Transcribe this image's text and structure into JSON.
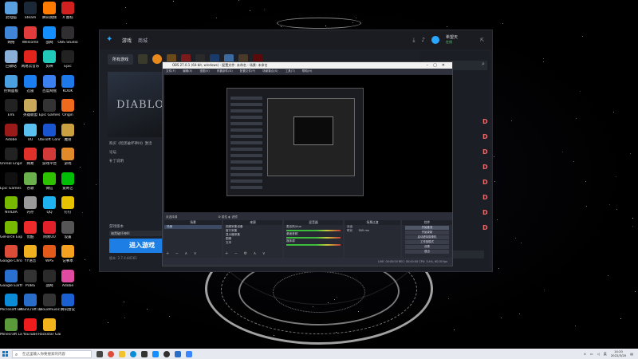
{
  "desktop": {
    "icons": [
      {
        "label": "此电脑",
        "color": "#5aa0e0"
      },
      {
        "label": "Steam",
        "color": "#1b2838"
      },
      {
        "label": "腾讯视频",
        "color": "#ff7a00"
      },
      {
        "label": "X 图标",
        "color": "#d02020"
      },
      {
        "label": "网络",
        "color": "#3f86d8"
      },
      {
        "label": "Welcome",
        "color": "#e23b3b"
      },
      {
        "label": "战网",
        "color": "#148eff"
      },
      {
        "label": "OBS Studio",
        "color": "#302e31"
      },
      {
        "label": "回收站",
        "color": "#8ab0d8"
      },
      {
        "label": "网易云音乐",
        "color": "#e2241d"
      },
      {
        "label": "剪映",
        "color": "#20c9b8"
      },
      {
        "label": "Epic",
        "color": "#222"
      },
      {
        "label": "控制面板",
        "color": "#4aa0e0"
      },
      {
        "label": "迅雷",
        "color": "#1a7ef0"
      },
      {
        "label": "百度网盘",
        "color": "#3b7ff0"
      },
      {
        "label": "KOOK",
        "color": "#1d78e8"
      },
      {
        "label": "EVE",
        "color": "#222"
      },
      {
        "label": "英雄联盟",
        "color": "#c8a85a"
      },
      {
        "label": "Epic Games",
        "color": "#333"
      },
      {
        "label": "Origin",
        "color": "#f06a1e"
      },
      {
        "label": "Adobe",
        "color": "#9a1a1a"
      },
      {
        "label": "UU",
        "color": "#5ac0f0"
      },
      {
        "label": "Ubisoft Connect",
        "color": "#1a55d0"
      },
      {
        "label": "魔兽",
        "color": "#caa040"
      },
      {
        "label": "Unreal Engine",
        "color": "#222"
      },
      {
        "label": "网易",
        "color": "#e0302a"
      },
      {
        "label": "游戏平台",
        "color": "#d23a3a"
      },
      {
        "label": "游戏",
        "color": "#e08a2a"
      },
      {
        "label": "Epic Games Launcher",
        "color": "#111"
      },
      {
        "label": "谷歌",
        "color": "#6ab04c"
      },
      {
        "label": "微信",
        "color": "#2dc100"
      },
      {
        "label": "爱奇艺",
        "color": "#00be06"
      },
      {
        "label": "NVIDIA",
        "color": "#76b900"
      },
      {
        "label": "内存",
        "color": "#9a9a9a"
      },
      {
        "label": "QQ",
        "color": "#1eb2f0"
      },
      {
        "label": "钉钉",
        "color": "#e6c200"
      },
      {
        "label": "GeForce Experience",
        "color": "#76b900"
      },
      {
        "label": "优酷",
        "color": "#ee2a2a"
      },
      {
        "label": "网易UU",
        "color": "#e2202a"
      },
      {
        "label": "设置",
        "color": "#555"
      },
      {
        "label": "Google Chrome",
        "color": "#dd4b39"
      },
      {
        "label": "YY语音",
        "color": "#f0b020"
      },
      {
        "label": "WPS",
        "color": "#e45a1a"
      },
      {
        "label": "记事本",
        "color": "#f4a020"
      },
      {
        "label": "Google Earth Pro",
        "color": "#2a70d0"
      },
      {
        "label": "PUBG",
        "color": "#333"
      },
      {
        "label": "战网",
        "color": "#2a2a2a"
      },
      {
        "label": "Adobe",
        "color": "#e04aa0"
      },
      {
        "label": "Microsoft Edge",
        "color": "#0c8bd6"
      },
      {
        "label": "PlainCraft Launcher",
        "color": "#2a6dc8"
      },
      {
        "label": "Cloudmusic",
        "color": "#333"
      },
      {
        "label": "腾讯会议",
        "color": "#1a60d0"
      },
      {
        "label": "Minecraft Launcher",
        "color": "#5a9a3a"
      },
      {
        "label": "YouTube",
        "color": "#ee1c1c"
      },
      {
        "label": "Rockstar Games",
        "color": "#f2b21c"
      }
    ]
  },
  "launcher": {
    "tabs": [
      "游戏",
      "商城"
    ],
    "user_name": "希望天",
    "user_status": "在线",
    "all_games_label": "所有游戏",
    "game_title": "DIABLO",
    "links": [
      "购买《暗黑破坏神III》激活",
      "论坛",
      "补丁说明"
    ],
    "region_label": "游戏版本",
    "region_value": "暗黑破坏神III",
    "region_sub": "亚洲",
    "play_button": "进入游戏",
    "version": "版本: 2.7.4.84161"
  },
  "obs": {
    "title": "OBS 27.0.1 (64-bit, windows) - 配置文件: 未命名 - 场景: 未命名",
    "menu": [
      "文件(F)",
      "编辑(E)",
      "视图(V)",
      "停靠部件(D)",
      "配置文件(P)",
      "场景集合(S)",
      "工具(T)",
      "帮助(H)"
    ],
    "source_bar": "未选择源",
    "properties_btn": "属性",
    "filters_btn": "滤镜",
    "docks": {
      "scenes": {
        "title": "场景",
        "items": [
          "场景"
        ]
      },
      "sources": {
        "title": "来源",
        "items": [
          "视频采集设备",
          "窗口采集",
          "显示器采集",
          "图像",
          "文本"
        ]
      },
      "mixer": {
        "title": "混音器",
        "items": [
          "麦克风/Aux",
          "桌面音频",
          "媒体源"
        ]
      },
      "transitions": {
        "title": "场景过渡",
        "type": "淡出",
        "duration_label": "时长",
        "duration": "300 ms"
      },
      "controls": {
        "title": "控件",
        "buttons": [
          "开始推流",
          "开始录制",
          "启动虚拟摄像机",
          "工作室模式",
          "设置",
          "退出"
        ]
      }
    },
    "status": "LIVE: 00:00:00   REC: 00:00:00   CPU: 3.4%, 60.00 fps"
  },
  "taskbar": {
    "search_placeholder": "在这里输入你要搜索的内容",
    "lang": "英",
    "time": "14:20",
    "date": "2022/3/20"
  }
}
